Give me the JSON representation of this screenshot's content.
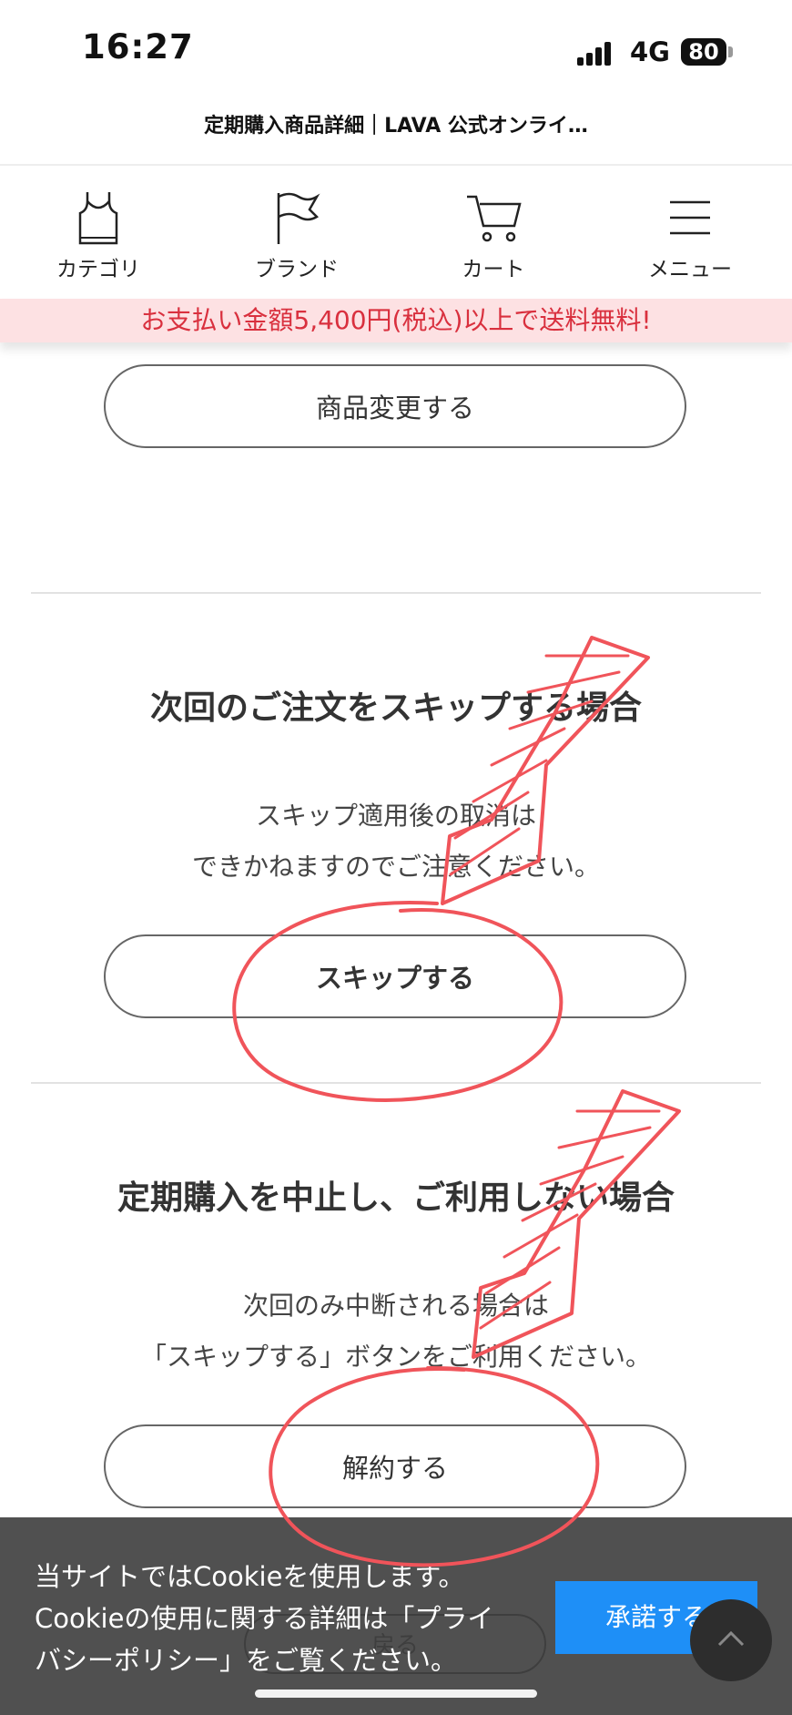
{
  "status_bar": {
    "time": "16:27",
    "network": "4G",
    "battery": "80"
  },
  "page_title": "定期購入商品詳細｜LAVA 公式オンライ…",
  "nav": {
    "category": "カテゴリ",
    "brand": "ブランド",
    "cart": "カート",
    "menu": "メニュー"
  },
  "promo_banner": "お支払い金額5,400円(税込)以上で送料無料!",
  "change_product_button": "商品変更する",
  "skip_section": {
    "heading": "次回のご注文をスキップする場合",
    "note_line1": "スキップ適用後の取消は",
    "note_line2": "できかねますのでご注意ください。",
    "button": "スキップする"
  },
  "cancel_section": {
    "heading": "定期購入を中止し、ご利用しない場合",
    "note_line1": "次回のみ中断される場合は",
    "note_line2": "「スキップする」ボタンをご利用ください。",
    "button": "解約する"
  },
  "back_button": "戻る",
  "cookie_banner": {
    "line1": "当サイトではCookieを使用します。",
    "line2": "Cookieの使用に関する詳細は「プライ",
    "line3": "バシーポリシー」をご覧ください。",
    "accept_button": "承諾する"
  },
  "colors": {
    "promo_text": "#d9303e",
    "promo_bg": "#fde1e3",
    "accept_button": "#1e8ff7",
    "annotation": "#f0545a"
  },
  "icons": [
    "tank-top-icon",
    "flag-icon",
    "cart-icon",
    "hamburger-menu-icon",
    "chevron-up-icon"
  ]
}
